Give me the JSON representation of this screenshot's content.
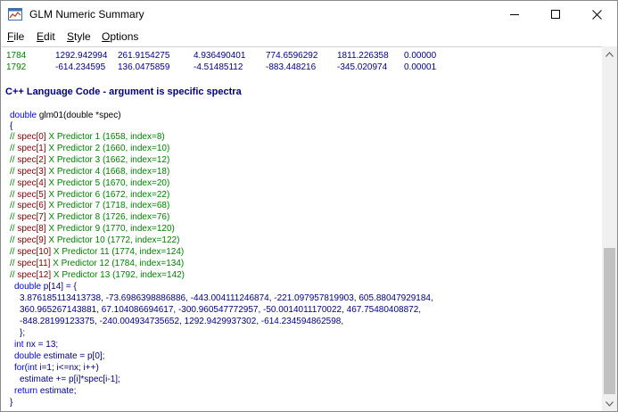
{
  "window": {
    "title": "GLM Numeric Summary"
  },
  "menu": {
    "file": "File",
    "edit": "Edit",
    "style": "Style",
    "options": "Options"
  },
  "table_rows": [
    {
      "wl": "1784",
      "c1": "1292.942994",
      "c2": "261.9154275",
      "c3": "4.936490401",
      "c4": "774.6596292",
      "c5": "1811.226358",
      "c6": "0.00000"
    },
    {
      "wl": "1792",
      "c1": "-614.234595",
      "c2": "136.0475859",
      "c3": "-4.51485112",
      "c4": "-883.448216",
      "c5": "-345.020974",
      "c6": "0.00001"
    }
  ],
  "section_title": "C++ Language Code - argument is specific spectra",
  "code": {
    "signature_type": "double",
    "signature_name": "glm01(double *spec)",
    "open_brace": "{",
    "comments": [
      {
        "slash": "// ",
        "spec": "spec[0]",
        "text": " X Predictor 1 (1658, index=8)"
      },
      {
        "slash": "// ",
        "spec": "spec[1]",
        "text": " X Predictor 2 (1660, index=10)"
      },
      {
        "slash": "// ",
        "spec": "spec[2]",
        "text": " X Predictor 3 (1662, index=12)"
      },
      {
        "slash": "// ",
        "spec": "spec[3]",
        "text": " X Predictor 4 (1668, index=18)"
      },
      {
        "slash": "// ",
        "spec": "spec[4]",
        "text": " X Predictor 5 (1670, index=20)"
      },
      {
        "slash": "// ",
        "spec": "spec[5]",
        "text": " X Predictor 6 (1672, index=22)"
      },
      {
        "slash": "// ",
        "spec": "spec[6]",
        "text": " X Predictor 7 (1718, index=68)"
      },
      {
        "slash": "// ",
        "spec": "spec[7]",
        "text": " X Predictor 8 (1726, index=76)"
      },
      {
        "slash": "// ",
        "spec": "spec[8]",
        "text": " X Predictor 9 (1770, index=120)"
      },
      {
        "slash": "// ",
        "spec": "spec[9]",
        "text": " X Predictor 10 (1772, index=122)"
      },
      {
        "slash": "// ",
        "spec": "spec[10]",
        "text": " X Predictor 11 (1774, index=124)"
      },
      {
        "slash": "// ",
        "spec": "spec[11]",
        "text": " X Predictor 12 (1784, index=134)"
      },
      {
        "slash": "// ",
        "spec": "spec[12]",
        "text": " X Predictor 13 (1792, index=142)"
      }
    ],
    "array_decl_type": "double",
    "array_decl_rest": " p[14] =  {",
    "array_values": [
      "3.876185113413738, -73.6986398886886, -443.004111246874, -221.097957819903, 605.88047929184,",
      "360.965267143881, 67.104086694617, -300.960547772957, -50.0014011170022, 467.75480408872,",
      "-848.28199123375, -240.004934735652, 1292.9429937302, -614.234594862598,"
    ],
    "array_close": "};",
    "int_kw": "int",
    "int_rest": " nx = 13;",
    "estimate_kw": "double",
    "estimate_rest": " estimate = p[0];",
    "for_kw": "for",
    "for_paren": "(",
    "for_int": "int",
    "for_rest": " i=1; i<=nx; i++)",
    "loop_body": "estimate += p[i]*spec[i-1];",
    "return_kw": "return",
    "return_rest": " estimate;",
    "close_brace": "}"
  },
  "colors": {
    "wavelength": "#008000",
    "values": "#000080",
    "keyword": "#0000ff",
    "comment": "#008000",
    "spec_ref": "#800000"
  }
}
